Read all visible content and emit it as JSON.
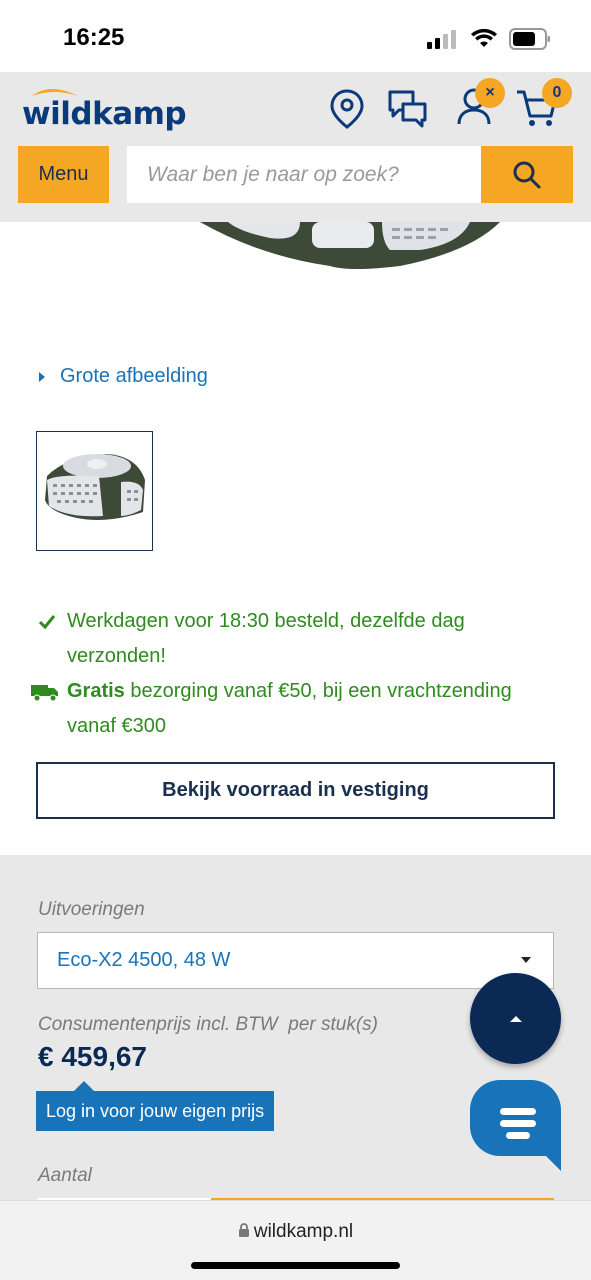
{
  "status": {
    "time": "16:25"
  },
  "header": {
    "logo": "wildkamp",
    "account_badge": "×",
    "cart_count": "0",
    "menu_label": "Menu",
    "search_placeholder": "Waar ben je naar op zoek?"
  },
  "product": {
    "big_image_label": "Grote afbeelding"
  },
  "usps": {
    "line1": "Werkdagen voor 18:30 besteld, dezelfde dag verzonden!",
    "line2_bold": "Gratis",
    "line2_rest": " bezorging vanaf €50, bij een vrachtzending vanaf €300"
  },
  "stock_button": "Bekijk voorraad in vestiging",
  "purchase": {
    "variants_label": "Uitvoeringen",
    "variant_selected": "Eco-X2 4500, 48 W",
    "price_label": "Consumentenprijs incl. BTW  per stuk(s)",
    "price": "€ 459,67",
    "login_price": "Log in voor jouw eigen prijs",
    "quantity_label": "Aantal"
  },
  "browser": {
    "url": "wildkamp.nl"
  },
  "colors": {
    "accent": "#f5a623",
    "brand_blue": "#0a3a7a",
    "link_blue": "#1873b8",
    "success": "#2e8b1e"
  }
}
